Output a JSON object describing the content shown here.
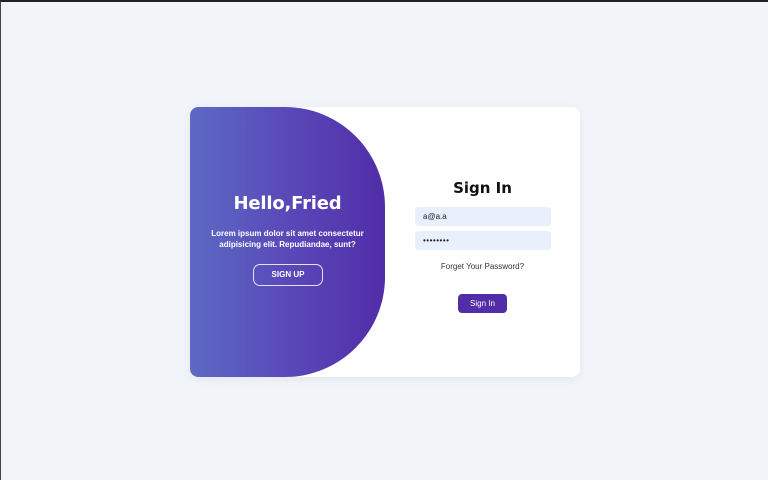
{
  "welcome_panel": {
    "title": "Hello,Fried",
    "text": "Lorem ipsum dolor sit amet consectetur adipisicing elit. Repudiandae, sunt?",
    "signup_label": "SIGN UP"
  },
  "signin_form": {
    "title": "Sign In",
    "email_value": "a@a.a",
    "password_value": "••••••••",
    "forget_password_label": "Forget Your Password?",
    "signin_label": "Sign In"
  },
  "colors": {
    "page_background": "#f1f4f9",
    "gradient_start": "#5c6ac4",
    "gradient_end": "#512da8",
    "button_accent": "#512da8",
    "input_background": "#e8f0fe"
  }
}
